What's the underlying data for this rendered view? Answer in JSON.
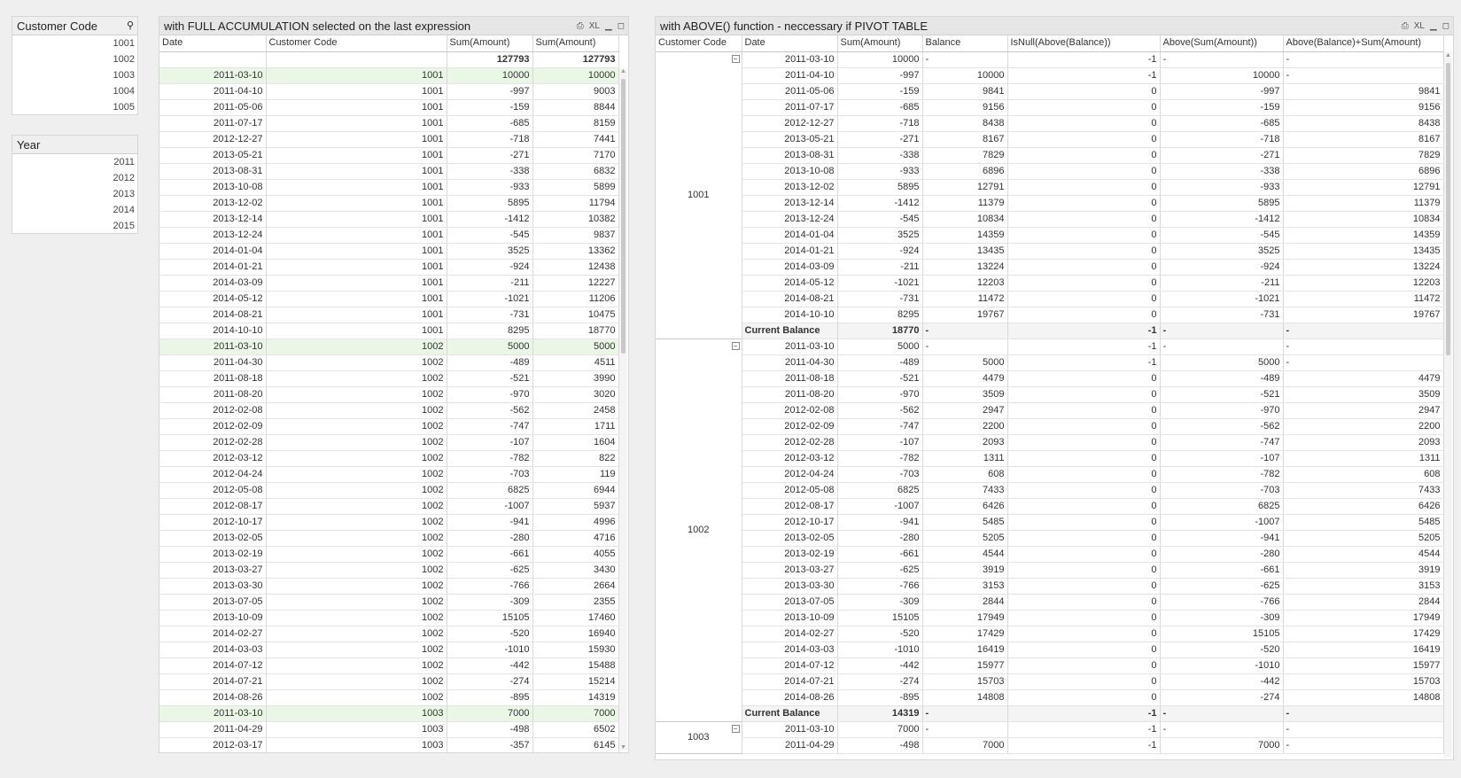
{
  "customer_listbox": {
    "title": "Customer Code",
    "items": [
      "1001",
      "1002",
      "1003",
      "1004",
      "1005"
    ]
  },
  "year_listbox": {
    "title": "Year",
    "items": [
      "2011",
      "2012",
      "2013",
      "2014",
      "2015"
    ]
  },
  "left_table": {
    "title": "with FULL ACCUMULATION selected on the last expression",
    "icons": [
      "print-icon",
      "xl-export-icon",
      "minimize-icon",
      "maximize-icon"
    ],
    "xl_label": "XL",
    "headers": [
      "Date",
      "Customer Code",
      "Sum(Amount)",
      "Sum(Amount)"
    ],
    "totals": [
      "",
      "",
      "127793",
      "127793"
    ],
    "rows": [
      [
        "2011-03-10",
        "1001",
        "10000",
        "10000",
        true
      ],
      [
        "2011-04-10",
        "1001",
        "-997",
        "9003",
        false
      ],
      [
        "2011-05-06",
        "1001",
        "-159",
        "8844",
        false
      ],
      [
        "2011-07-17",
        "1001",
        "-685",
        "8159",
        false
      ],
      [
        "2012-12-27",
        "1001",
        "-718",
        "7441",
        false
      ],
      [
        "2013-05-21",
        "1001",
        "-271",
        "7170",
        false
      ],
      [
        "2013-08-31",
        "1001",
        "-338",
        "6832",
        false
      ],
      [
        "2013-10-08",
        "1001",
        "-933",
        "5899",
        false
      ],
      [
        "2013-12-02",
        "1001",
        "5895",
        "11794",
        false
      ],
      [
        "2013-12-14",
        "1001",
        "-1412",
        "10382",
        false
      ],
      [
        "2013-12-24",
        "1001",
        "-545",
        "9837",
        false
      ],
      [
        "2014-01-04",
        "1001",
        "3525",
        "13362",
        false
      ],
      [
        "2014-01-21",
        "1001",
        "-924",
        "12438",
        false
      ],
      [
        "2014-03-09",
        "1001",
        "-211",
        "12227",
        false
      ],
      [
        "2014-05-12",
        "1001",
        "-1021",
        "11206",
        false
      ],
      [
        "2014-08-21",
        "1001",
        "-731",
        "10475",
        false
      ],
      [
        "2014-10-10",
        "1001",
        "8295",
        "18770",
        false
      ],
      [
        "2011-03-10",
        "1002",
        "5000",
        "5000",
        true
      ],
      [
        "2011-04-30",
        "1002",
        "-489",
        "4511",
        false
      ],
      [
        "2011-08-18",
        "1002",
        "-521",
        "3990",
        false
      ],
      [
        "2011-08-20",
        "1002",
        "-970",
        "3020",
        false
      ],
      [
        "2012-02-08",
        "1002",
        "-562",
        "2458",
        false
      ],
      [
        "2012-02-09",
        "1002",
        "-747",
        "1711",
        false
      ],
      [
        "2012-02-28",
        "1002",
        "-107",
        "1604",
        false
      ],
      [
        "2012-03-12",
        "1002",
        "-782",
        "822",
        false
      ],
      [
        "2012-04-24",
        "1002",
        "-703",
        "119",
        false
      ],
      [
        "2012-05-08",
        "1002",
        "6825",
        "6944",
        false
      ],
      [
        "2012-08-17",
        "1002",
        "-1007",
        "5937",
        false
      ],
      [
        "2012-10-17",
        "1002",
        "-941",
        "4996",
        false
      ],
      [
        "2013-02-05",
        "1002",
        "-280",
        "4716",
        false
      ],
      [
        "2013-02-19",
        "1002",
        "-661",
        "4055",
        false
      ],
      [
        "2013-03-27",
        "1002",
        "-625",
        "3430",
        false
      ],
      [
        "2013-03-30",
        "1002",
        "-766",
        "2664",
        false
      ],
      [
        "2013-07-05",
        "1002",
        "-309",
        "2355",
        false
      ],
      [
        "2013-10-09",
        "1002",
        "15105",
        "17460",
        false
      ],
      [
        "2014-02-27",
        "1002",
        "-520",
        "16940",
        false
      ],
      [
        "2014-03-03",
        "1002",
        "-1010",
        "15930",
        false
      ],
      [
        "2014-07-12",
        "1002",
        "-442",
        "15488",
        false
      ],
      [
        "2014-07-21",
        "1002",
        "-274",
        "15214",
        false
      ],
      [
        "2014-08-26",
        "1002",
        "-895",
        "14319",
        false
      ],
      [
        "2011-03-10",
        "1003",
        "7000",
        "7000",
        true
      ],
      [
        "2011-04-29",
        "1003",
        "-498",
        "6502",
        false
      ],
      [
        "2012-03-17",
        "1003",
        "-357",
        "6145",
        false
      ]
    ]
  },
  "right_table": {
    "title": "with ABOVE() function - neccessary if PIVOT TABLE",
    "icons": [
      "print-icon",
      "xl-export-icon",
      "minimize-icon",
      "maximize-icon"
    ],
    "xl_label": "XL",
    "headers": [
      "Customer Code",
      "Date",
      "Sum(Amount)",
      "Balance",
      "IsNull(Above(Balance))",
      "Above(Sum(Amount))",
      "Above(Balance)+Sum(Amount)"
    ],
    "total_label": "Current Balance",
    "groups": [
      {
        "code": "1001",
        "rows": [
          [
            "2011-03-10",
            "10000",
            "-",
            "-1",
            "-",
            "-"
          ],
          [
            "2011-04-10",
            "-997",
            "10000",
            "-1",
            "10000",
            "-"
          ],
          [
            "2011-05-06",
            "-159",
            "9841",
            "0",
            "-997",
            "9841"
          ],
          [
            "2011-07-17",
            "-685",
            "9156",
            "0",
            "-159",
            "9156"
          ],
          [
            "2012-12-27",
            "-718",
            "8438",
            "0",
            "-685",
            "8438"
          ],
          [
            "2013-05-21",
            "-271",
            "8167",
            "0",
            "-718",
            "8167"
          ],
          [
            "2013-08-31",
            "-338",
            "7829",
            "0",
            "-271",
            "7829"
          ],
          [
            "2013-10-08",
            "-933",
            "6896",
            "0",
            "-338",
            "6896"
          ],
          [
            "2013-12-02",
            "5895",
            "12791",
            "0",
            "-933",
            "12791"
          ],
          [
            "2013-12-14",
            "-1412",
            "11379",
            "0",
            "5895",
            "11379"
          ],
          [
            "2013-12-24",
            "-545",
            "10834",
            "0",
            "-1412",
            "10834"
          ],
          [
            "2014-01-04",
            "3525",
            "14359",
            "0",
            "-545",
            "14359"
          ],
          [
            "2014-01-21",
            "-924",
            "13435",
            "0",
            "3525",
            "13435"
          ],
          [
            "2014-03-09",
            "-211",
            "13224",
            "0",
            "-924",
            "13224"
          ],
          [
            "2014-05-12",
            "-1021",
            "12203",
            "0",
            "-211",
            "12203"
          ],
          [
            "2014-08-21",
            "-731",
            "11472",
            "0",
            "-1021",
            "11472"
          ],
          [
            "2014-10-10",
            "8295",
            "19767",
            "0",
            "-731",
            "19767"
          ]
        ],
        "total": [
          "18770",
          "-",
          "-1",
          "-",
          "-"
        ]
      },
      {
        "code": "1002",
        "rows": [
          [
            "2011-03-10",
            "5000",
            "-",
            "-1",
            "-",
            "-"
          ],
          [
            "2011-04-30",
            "-489",
            "5000",
            "-1",
            "5000",
            "-"
          ],
          [
            "2011-08-18",
            "-521",
            "4479",
            "0",
            "-489",
            "4479"
          ],
          [
            "2011-08-20",
            "-970",
            "3509",
            "0",
            "-521",
            "3509"
          ],
          [
            "2012-02-08",
            "-562",
            "2947",
            "0",
            "-970",
            "2947"
          ],
          [
            "2012-02-09",
            "-747",
            "2200",
            "0",
            "-562",
            "2200"
          ],
          [
            "2012-02-28",
            "-107",
            "2093",
            "0",
            "-747",
            "2093"
          ],
          [
            "2012-03-12",
            "-782",
            "1311",
            "0",
            "-107",
            "1311"
          ],
          [
            "2012-04-24",
            "-703",
            "608",
            "0",
            "-782",
            "608"
          ],
          [
            "2012-05-08",
            "6825",
            "7433",
            "0",
            "-703",
            "7433"
          ],
          [
            "2012-08-17",
            "-1007",
            "6426",
            "0",
            "6825",
            "6426"
          ],
          [
            "2012-10-17",
            "-941",
            "5485",
            "0",
            "-1007",
            "5485"
          ],
          [
            "2013-02-05",
            "-280",
            "5205",
            "0",
            "-941",
            "5205"
          ],
          [
            "2013-02-19",
            "-661",
            "4544",
            "0",
            "-280",
            "4544"
          ],
          [
            "2013-03-27",
            "-625",
            "3919",
            "0",
            "-661",
            "3919"
          ],
          [
            "2013-03-30",
            "-766",
            "3153",
            "0",
            "-625",
            "3153"
          ],
          [
            "2013-07-05",
            "-309",
            "2844",
            "0",
            "-766",
            "2844"
          ],
          [
            "2013-10-09",
            "15105",
            "17949",
            "0",
            "-309",
            "17949"
          ],
          [
            "2014-02-27",
            "-520",
            "17429",
            "0",
            "15105",
            "17429"
          ],
          [
            "2014-03-03",
            "-1010",
            "16419",
            "0",
            "-520",
            "16419"
          ],
          [
            "2014-07-12",
            "-442",
            "15977",
            "0",
            "-1010",
            "15977"
          ],
          [
            "2014-07-21",
            "-274",
            "15703",
            "0",
            "-442",
            "15703"
          ],
          [
            "2014-08-26",
            "-895",
            "14808",
            "0",
            "-274",
            "14808"
          ]
        ],
        "total": [
          "14319",
          "-",
          "-1",
          "-",
          "-"
        ]
      },
      {
        "code": "1003",
        "rows": [
          [
            "2011-03-10",
            "7000",
            "-",
            "-1",
            "-",
            "-"
          ],
          [
            "2011-04-29",
            "-498",
            "7000",
            "-1",
            "7000",
            "-"
          ]
        ],
        "total": null
      }
    ]
  }
}
